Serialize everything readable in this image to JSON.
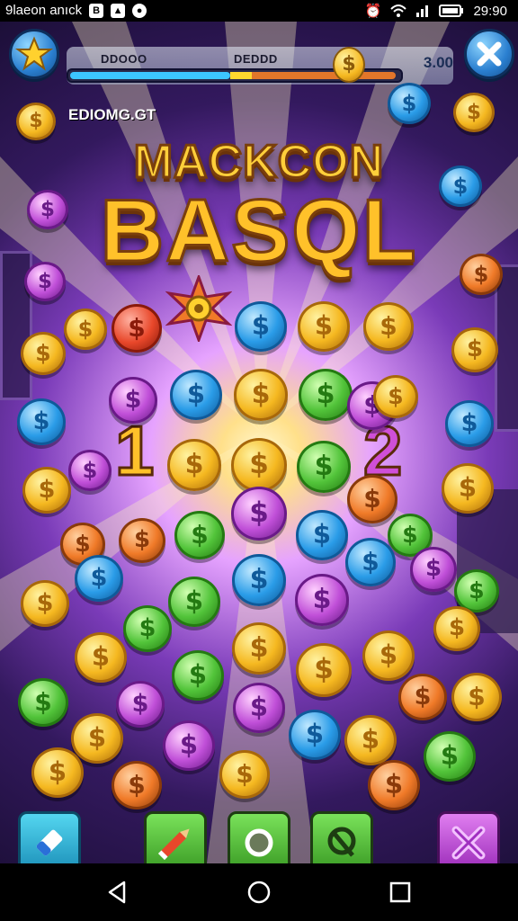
{
  "status_bar": {
    "left_text": "9laeon anıck",
    "icons": [
      "notification-icon",
      "image-icon",
      "chat-icon"
    ],
    "right_icons": [
      "alarm-icon",
      "wifi-icon",
      "signal-icon",
      "battery-icon"
    ],
    "time": "29:90"
  },
  "hud": {
    "menu_button_icon": "star-icon",
    "close_button_icon": "close-icon",
    "progress_left_label": "DDOOO",
    "progress_right_label": "DEDDD",
    "score": "3.00",
    "progress_fraction": 0.6,
    "level_label": "EDIOMG.GT"
  },
  "title": {
    "line1": "MACKCON",
    "line2": "BASQL"
  },
  "board": {
    "left_number": "1",
    "right_number": "2"
  },
  "toolbar": {
    "items": [
      {
        "name": "eraser-tool",
        "icon": "eraser-icon",
        "color": "#2fb8d8"
      },
      {
        "name": "pencil-tool",
        "icon": "pencil-icon",
        "color": "#52c43a"
      },
      {
        "name": "circle-tool",
        "icon": "circle-icon",
        "color": "#52c43a"
      },
      {
        "name": "tag-tool",
        "icon": "tag-icon",
        "color": "#52c43a"
      },
      {
        "name": "cross-tool",
        "icon": "cross-icon",
        "color": "#c04fd8"
      }
    ]
  },
  "nav_bar": {
    "icons": [
      "back-icon",
      "home-icon",
      "recents-icon"
    ]
  },
  "palette": {
    "gold": "#f5b820",
    "blue": "#2a9ce8",
    "green": "#52c43a",
    "purple": "#c04fd8",
    "orange": "#f07a28",
    "red": "#e8472a",
    "background": "#3a1d6a"
  }
}
